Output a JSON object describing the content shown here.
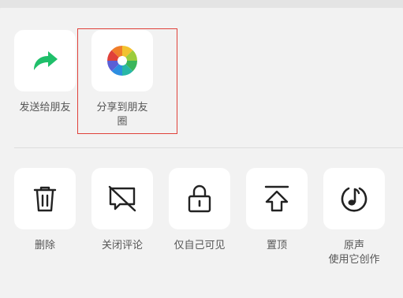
{
  "share_row": {
    "items": [
      {
        "label": "发送给朋友",
        "icon": "share-arrow-icon",
        "accent": "#1fbf6a"
      },
      {
        "label": "分享到朋友\n圈",
        "icon": "moments-aperture-icon"
      }
    ]
  },
  "actions_row": {
    "items": [
      {
        "label": "删除",
        "icon": "trash-icon"
      },
      {
        "label": "关闭评论",
        "icon": "comment-off-icon"
      },
      {
        "label": "仅自己可见",
        "icon": "lock-icon"
      },
      {
        "label": "置顶",
        "icon": "pin-top-icon"
      },
      {
        "label": "原声\n使用它创作",
        "icon": "music-note-icon"
      }
    ]
  },
  "highlight": {
    "color": "#e0413a"
  }
}
